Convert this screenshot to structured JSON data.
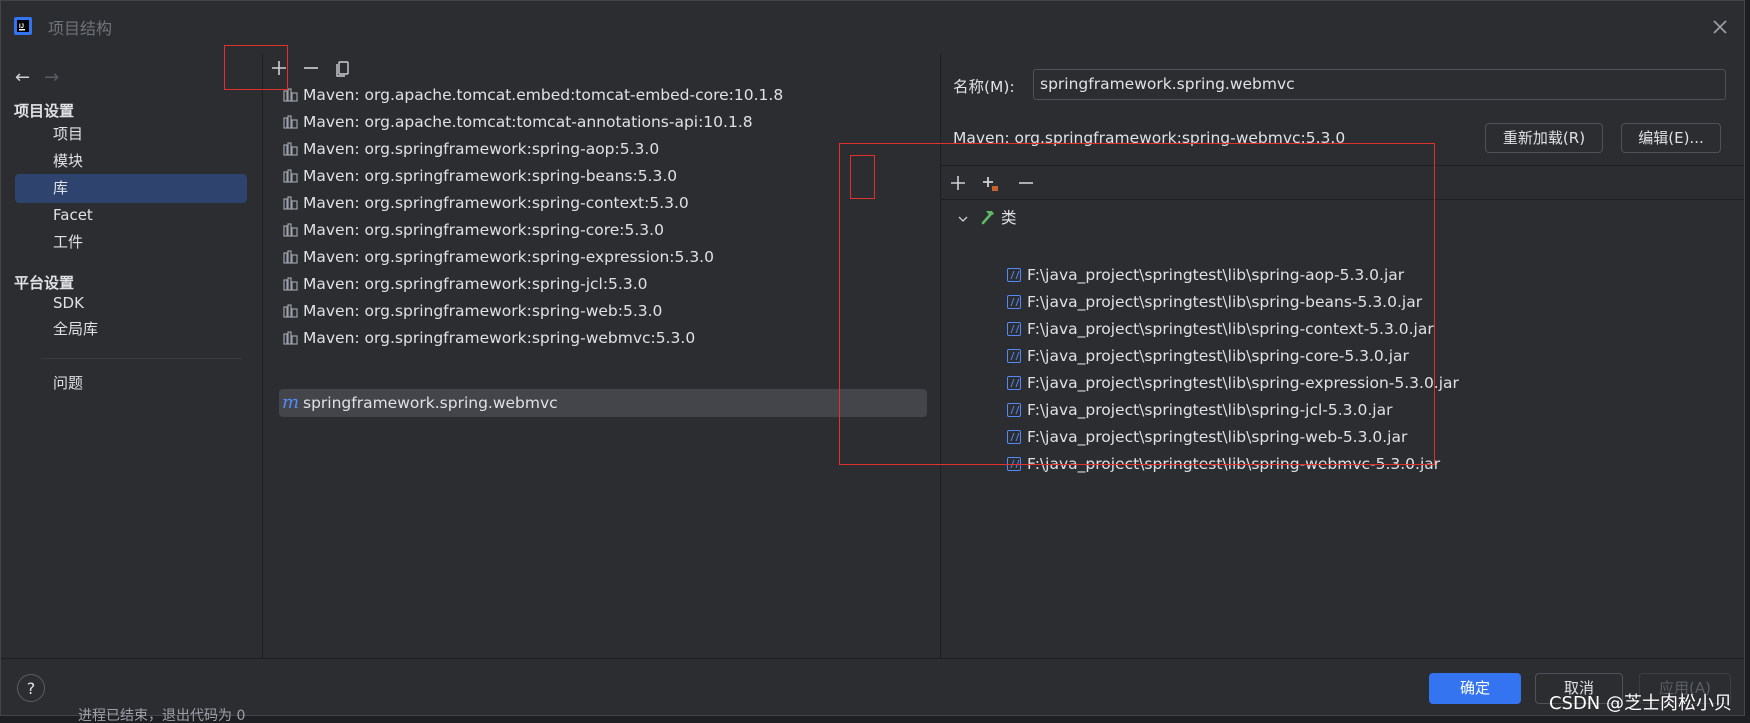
{
  "window": {
    "title": "项目结构"
  },
  "nav": {
    "back_arrow": "←",
    "forward_arrow": "→",
    "section_project": "项目设置",
    "project_items": [
      {
        "label": "项目",
        "selected": false
      },
      {
        "label": "模块",
        "selected": false
      },
      {
        "label": "库",
        "selected": true
      },
      {
        "label": "Facet",
        "selected": false
      },
      {
        "label": "工件",
        "selected": false
      }
    ],
    "section_platform": "平台设置",
    "platform_items": [
      {
        "label": "SDK"
      },
      {
        "label": "全局库"
      }
    ],
    "problems": "问题"
  },
  "libraries": {
    "toolbar": {
      "add": "+",
      "remove": "−"
    },
    "items": [
      "Maven: org.apache.tomcat.embed:tomcat-embed-core:10.1.8",
      "Maven: org.apache.tomcat:tomcat-annotations-api:10.1.8",
      "Maven: org.springframework:spring-aop:5.3.0",
      "Maven: org.springframework:spring-beans:5.3.0",
      "Maven: org.springframework:spring-context:5.3.0",
      "Maven: org.springframework:spring-core:5.3.0",
      "Maven: org.springframework:spring-expression:5.3.0",
      "Maven: org.springframework:spring-jcl:5.3.0",
      "Maven: org.springframework:spring-web:5.3.0",
      "Maven: org.springframework:spring-webmvc:5.3.0"
    ],
    "selected_item": {
      "icon_letter": "m",
      "label": "springframework.spring.webmvc"
    }
  },
  "details": {
    "name_label": "名称(M):",
    "name_value": "springframework.spring.webmvc",
    "maven_coordinates": "Maven: org.springframework:spring-webmvc:5.3.0",
    "reload_button": "重新加载(R)",
    "edit_button": "编辑(E)...",
    "roots_toolbar": {
      "add": "+",
      "add_alt": "+",
      "remove": "−"
    },
    "classes_node": "类",
    "jars": [
      "F:\\java_project\\springtest\\lib\\spring-aop-5.3.0.jar",
      "F:\\java_project\\springtest\\lib\\spring-beans-5.3.0.jar",
      "F:\\java_project\\springtest\\lib\\spring-context-5.3.0.jar",
      "F:\\java_project\\springtest\\lib\\spring-core-5.3.0.jar",
      "F:\\java_project\\springtest\\lib\\spring-expression-5.3.0.jar",
      "F:\\java_project\\springtest\\lib\\spring-jcl-5.3.0.jar",
      "F:\\java_project\\springtest\\lib\\spring-web-5.3.0.jar",
      "F:\\java_project\\springtest\\lib\\spring-webmvc-5.3.0.jar"
    ]
  },
  "footer": {
    "help": "?",
    "ok": "确定",
    "cancel": "取消",
    "apply": "应用(A)"
  },
  "background": {
    "status_text": "进程已结束，退出代码为 0"
  },
  "watermark": "CSDN @芝士肉松小贝",
  "colors": {
    "accent": "#3574f0",
    "selection": "#2e436e",
    "annotation": "#e0312c"
  }
}
